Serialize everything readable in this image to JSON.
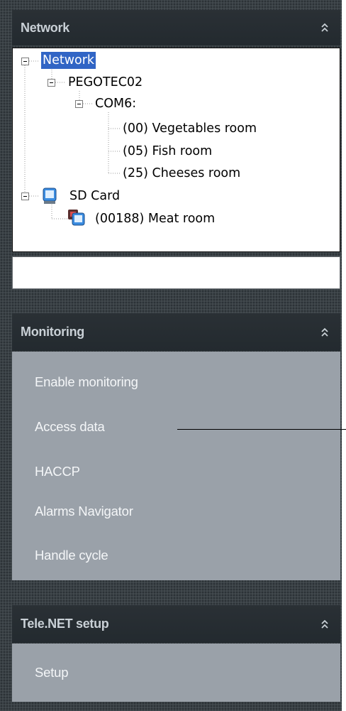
{
  "network": {
    "header": "Network",
    "tree": {
      "root": "Network",
      "host": "PEGOTEC02",
      "port": "COM6:",
      "devices": [
        "(00) Vegetables room",
        "(05) Fish room",
        "(25) Cheeses room"
      ],
      "sd_card": "SD Card",
      "sd_device": "(00188) Meat room"
    },
    "status_value": ""
  },
  "monitoring": {
    "header": "Monitoring",
    "items": [
      "Enable monitoring",
      "Access data",
      "HACCP",
      "Alarms Navigator",
      "Handle cycle"
    ]
  },
  "telenet": {
    "header": "Tele.NET setup",
    "items": [
      "Setup"
    ]
  },
  "icons": {
    "collapse": "double-chevron-up-icon",
    "expander": "tree-minus-icon",
    "sd_card": "sd-card-icon",
    "device": "device-icon"
  },
  "colors": {
    "sidebar_bg": "#3a4146",
    "panel_bg": "#9aa1a9",
    "header_text": "#c9d0d6",
    "selection": "#3165c5"
  }
}
